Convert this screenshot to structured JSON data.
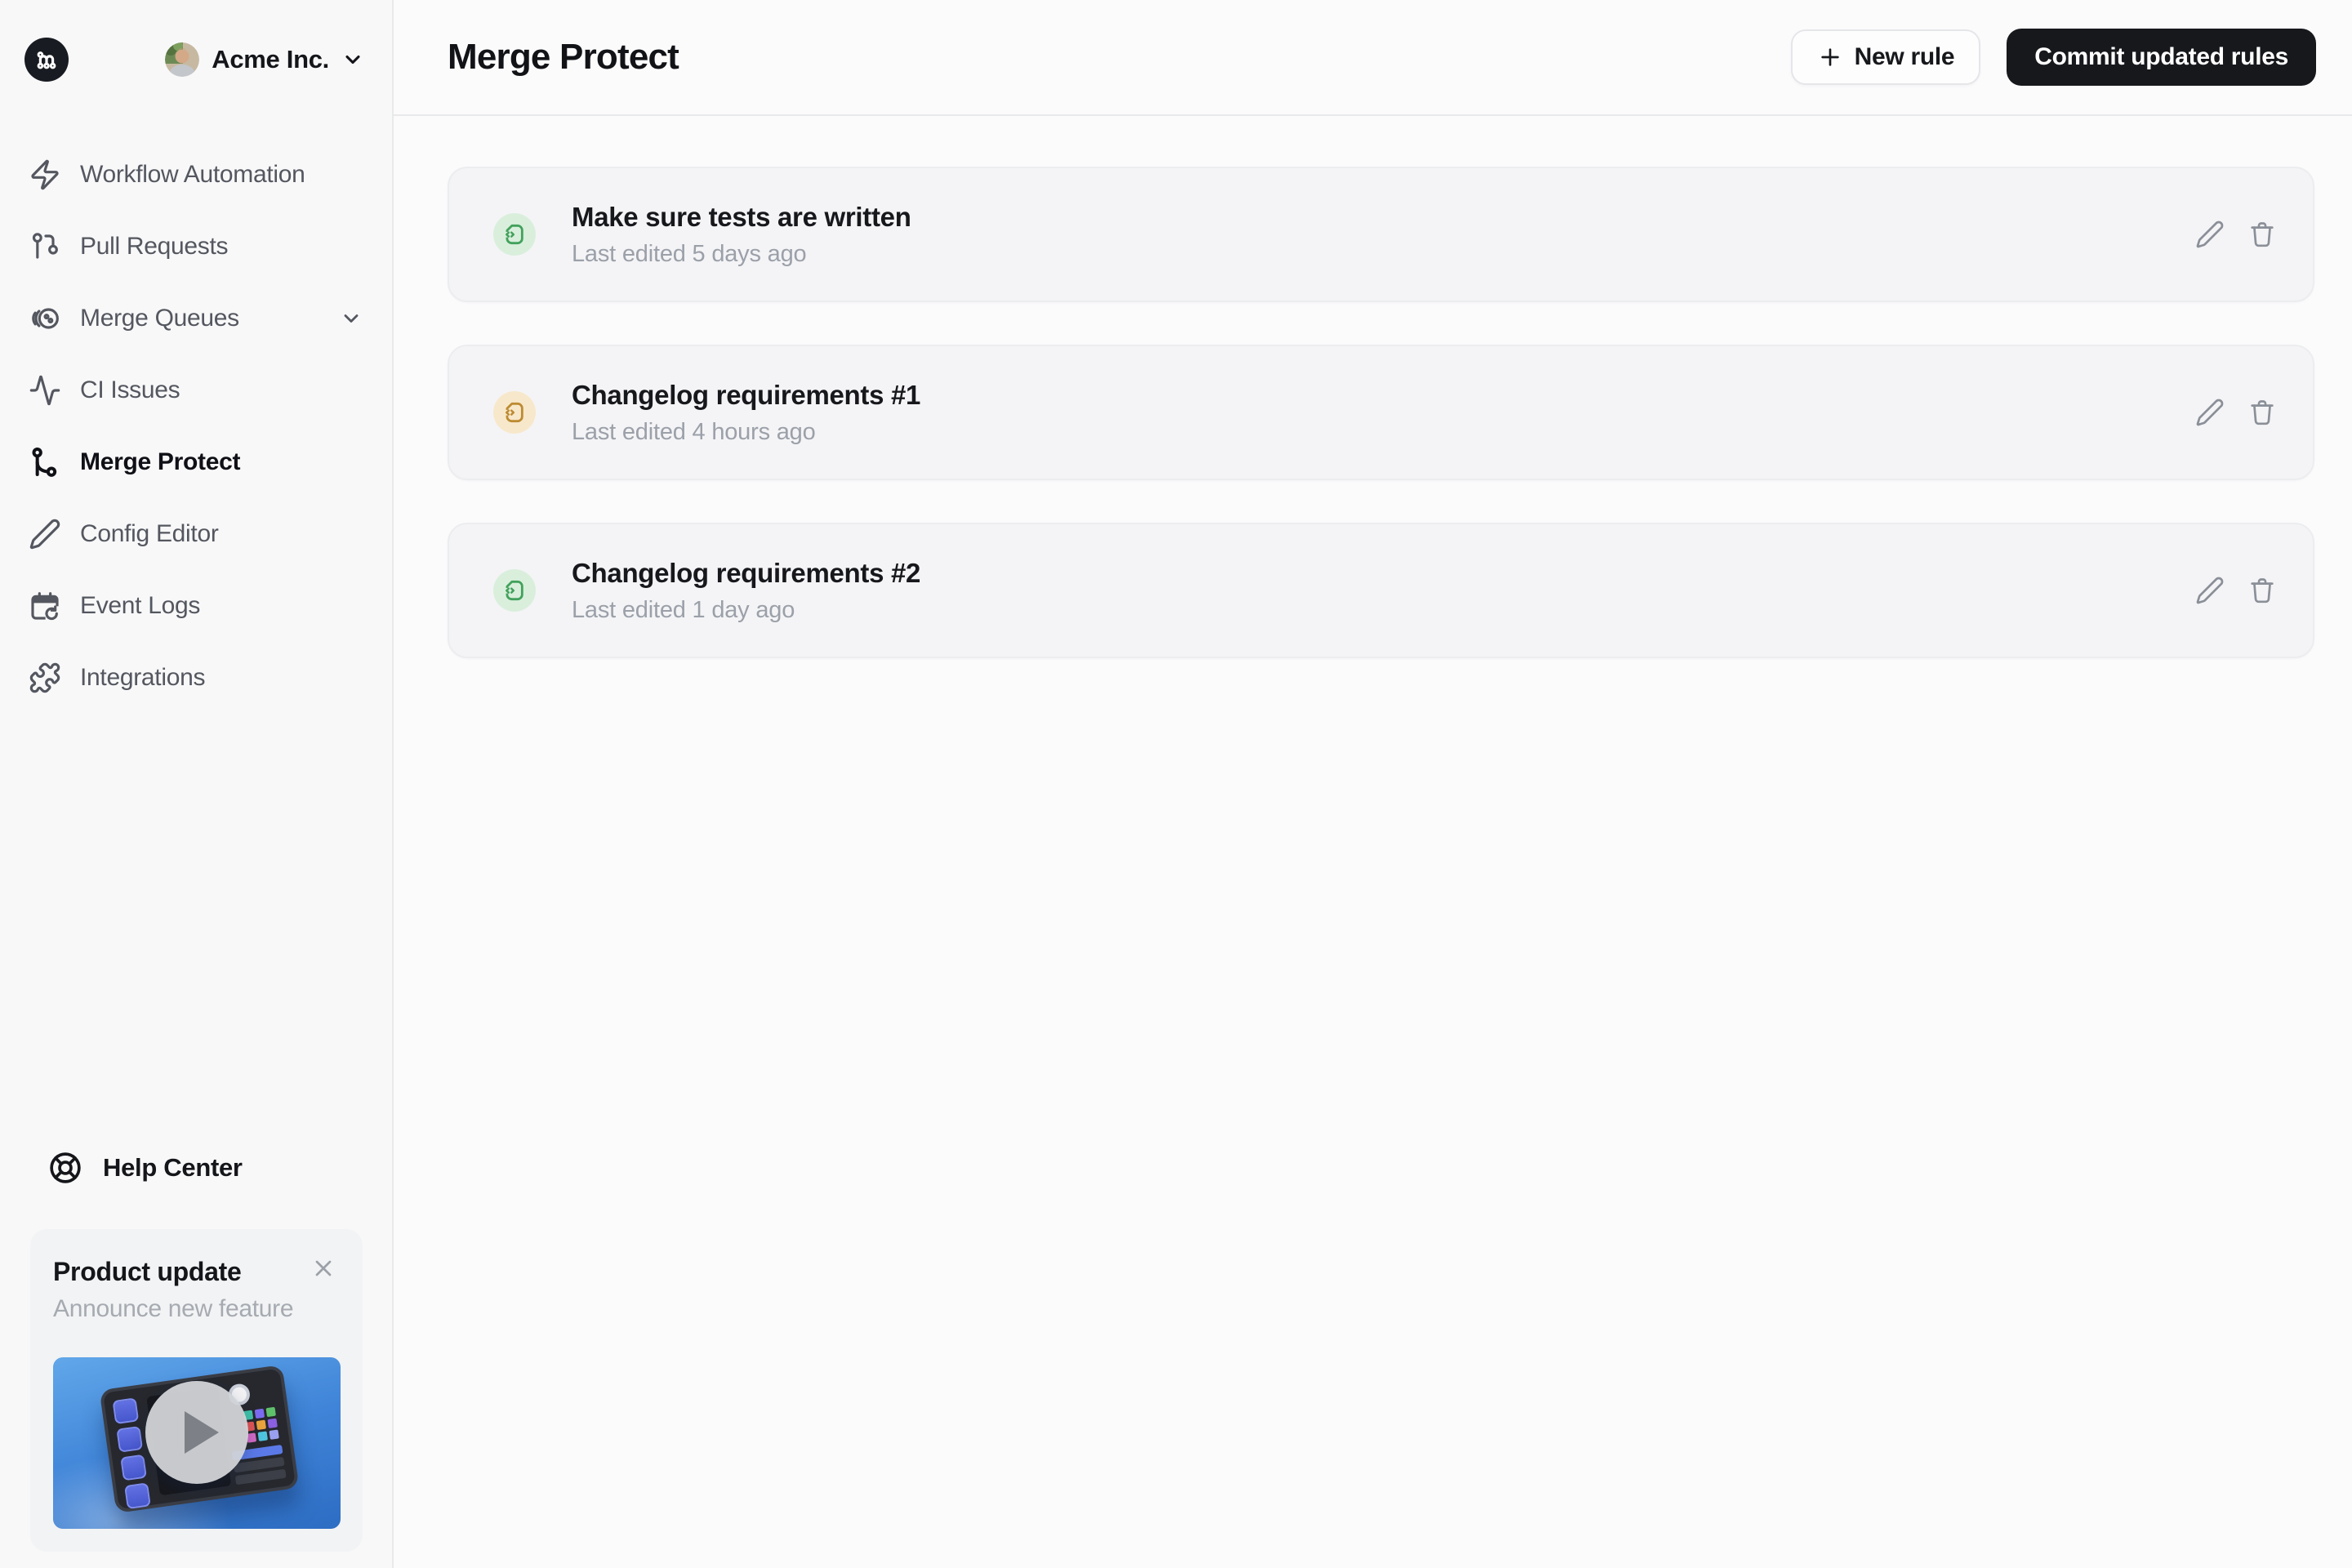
{
  "org": {
    "name": "Acme Inc."
  },
  "sidebar": {
    "items": [
      {
        "label": "Workflow Automation",
        "icon": "zap-icon",
        "active": false
      },
      {
        "label": "Pull Requests",
        "icon": "pull-request-icon",
        "active": false
      },
      {
        "label": "Merge Queues",
        "icon": "merge-queues-icon",
        "active": false,
        "expandable": true
      },
      {
        "label": "CI Issues",
        "icon": "activity-icon",
        "active": false
      },
      {
        "label": "Merge Protect",
        "icon": "branch-icon",
        "active": true
      },
      {
        "label": "Config Editor",
        "icon": "pen-icon",
        "active": false
      },
      {
        "label": "Event Logs",
        "icon": "calendar-history-icon",
        "active": false
      },
      {
        "label": "Integrations",
        "icon": "puzzle-icon",
        "active": false
      }
    ],
    "help": {
      "label": "Help Center",
      "icon": "lifebuoy-icon"
    },
    "promo": {
      "title": "Product update",
      "subtitle": "Announce new feature",
      "media": "video-thumbnail-with-play-button"
    }
  },
  "header": {
    "title": "Merge Protect",
    "new_rule_label": "New rule",
    "commit_label": "Commit updated rules"
  },
  "rules": [
    {
      "title": "Make sure tests are written",
      "edited": "Last edited 5 days ago",
      "accent": "green"
    },
    {
      "title": "Changelog requirements #1",
      "edited": "Last edited 4 hours ago",
      "accent": "orange"
    },
    {
      "title": "Changelog requirements #2",
      "edited": "Last edited 1 day ago",
      "accent": "green"
    }
  ],
  "colors": {
    "accents": {
      "green": {
        "bg": "#D9EFDC",
        "fg": "#43A15C"
      },
      "orange": {
        "bg": "#F8E8CB",
        "fg": "#BC8B33"
      }
    },
    "brand_dark": "#17181C",
    "sidebar_bg": "#F8F8F9",
    "card_bg": "#F4F4F6"
  }
}
